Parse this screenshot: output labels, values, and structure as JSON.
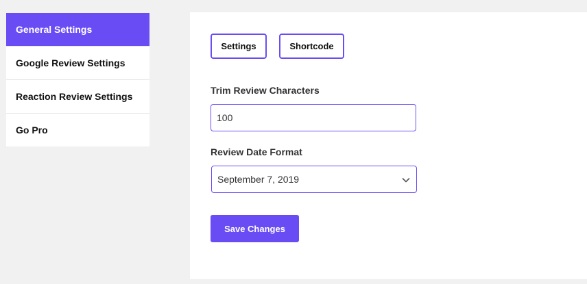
{
  "sidebar": {
    "items": [
      {
        "label": "General Settings",
        "active": true
      },
      {
        "label": "Google Review Settings",
        "active": false
      },
      {
        "label": "Reaction Review Settings",
        "active": false
      },
      {
        "label": "Go Pro",
        "active": false
      }
    ]
  },
  "tabs": {
    "settings_label": "Settings",
    "shortcode_label": "Shortcode"
  },
  "form": {
    "trim_label": "Trim Review Characters",
    "trim_value": "100",
    "date_label": "Review Date Format",
    "date_value": "September 7, 2019",
    "date_icon": "chevron-down-icon"
  },
  "actions": {
    "save_label": "Save Changes"
  },
  "colors": {
    "accent": "#6a4cf5",
    "background": "#f1f1f1",
    "panel": "#ffffff"
  }
}
